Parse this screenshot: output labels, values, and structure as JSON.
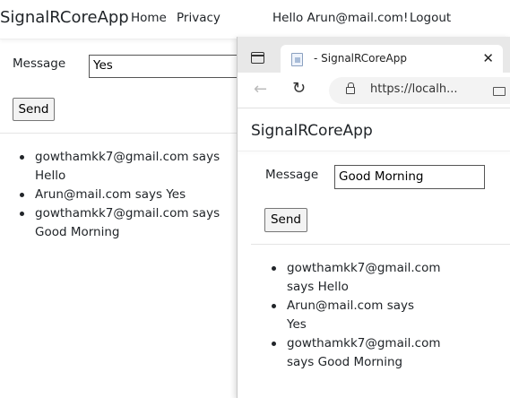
{
  "back_page": {
    "nav": {
      "brand": "SignalRCoreApp",
      "home": "Home",
      "privacy": "Privacy",
      "greeting": "Hello Arun@mail.com!",
      "logout": "Logout"
    },
    "form": {
      "message_label": "Message",
      "message_value": "Yes",
      "send_label": "Send"
    },
    "messages": [
      "gowthamkk7@gmail.com says Hello",
      "Arun@mail.com says Yes",
      "gowthamkk7@gmail.com says Good Morning"
    ]
  },
  "front_window": {
    "tab": {
      "title": "- SignalRCoreApp",
      "close_glyph": "✕"
    },
    "toolbar": {
      "back_glyph": "←",
      "refresh_glyph": "↻",
      "url": "https://localh..."
    },
    "page": {
      "brand": "SignalRCoreApp",
      "message_label": "Message",
      "message_value": "Good Morning",
      "send_label": "Send",
      "messages": [
        "gowthamkk7@gmail.com says Hello",
        "Arun@mail.com says Yes",
        "gowthamkk7@gmail.com says Good Morning"
      ]
    }
  },
  "icons": {
    "sidebar": "sidebar-icon",
    "favicon": "page-favicon-icon",
    "lock": "lock-icon",
    "reader": "reader-mode-icon"
  }
}
